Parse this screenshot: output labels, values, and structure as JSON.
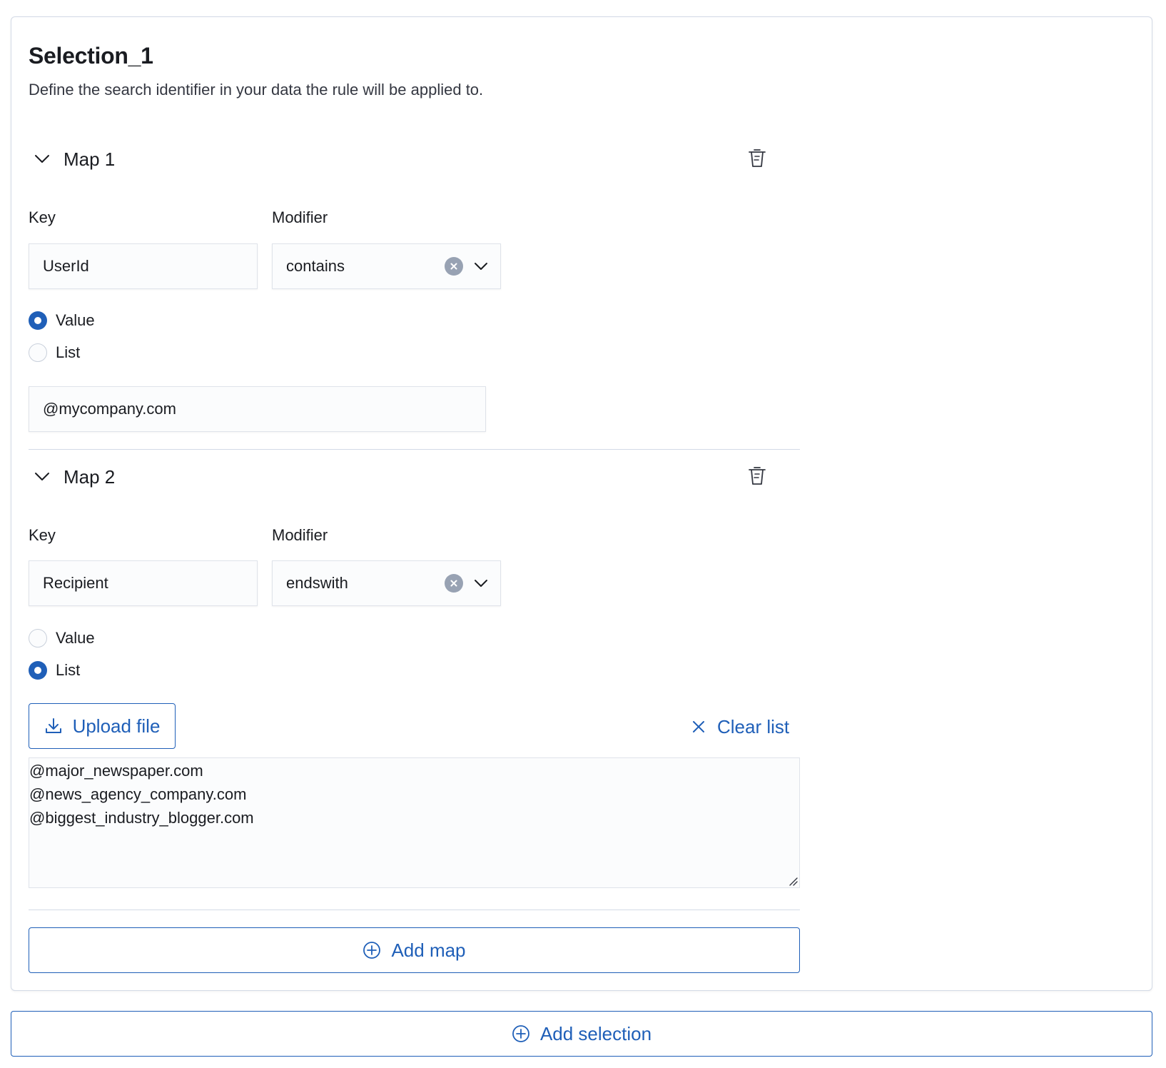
{
  "selection": {
    "title": "Selection_1",
    "description": "Define the search identifier in your data the rule will be applied to."
  },
  "maps": [
    {
      "title": "Map 1",
      "key_label": "Key",
      "modifier_label": "Modifier",
      "key_value": "UserId",
      "modifier_value": "contains",
      "radio_value_label": "Value",
      "radio_list_label": "List",
      "selected": "Value",
      "value_text": "@mycompany.com"
    },
    {
      "title": "Map 2",
      "key_label": "Key",
      "modifier_label": "Modifier",
      "key_value": "Recipient",
      "modifier_value": "endswith",
      "radio_value_label": "Value",
      "radio_list_label": "List",
      "selected": "List",
      "upload_label": "Upload file",
      "clear_label": "Clear list",
      "list_items": [
        "@major_newspaper.com",
        "@news_agency_company.com",
        "@biggest_industry_blogger.com"
      ]
    }
  ],
  "actions": {
    "add_map": "Add map",
    "add_selection": "Add selection"
  },
  "colors": {
    "primary": "#1f5fb8",
    "border": "#d3dae6",
    "field_bg": "#fbfcfd",
    "text": "#1a1c21",
    "clear_icon_bg": "#98a2b3"
  }
}
